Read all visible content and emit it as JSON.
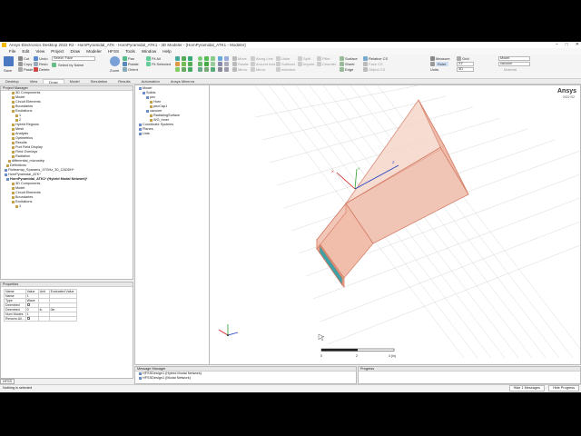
{
  "window": {
    "title": "Ansys Electronics Desktop 2022 R2 - HornPyramidal_ATK - HornPyramidal_ATK1 - 3D Modeler - [HornPyramidal_ATK1 - Modeler]",
    "controls": [
      "–",
      "□",
      "✕"
    ]
  },
  "menu": [
    "File",
    "Edit",
    "View",
    "Project",
    "Draw",
    "Modeler",
    "HFSS",
    "Tools",
    "Window",
    "Help"
  ],
  "ribbon": {
    "save": "Save",
    "cut": "Cut",
    "copy": "Copy",
    "paste": "Paste",
    "delete": "Delete",
    "undo": "Undo",
    "redo": "Redo",
    "select_label": "Select: Face",
    "select_by_name": "Select by Name",
    "zoom": "Zoom",
    "pan": "Pan",
    "rotate": "Rotate",
    "orient": "Orient",
    "fit_all": "Fit All",
    "fit_selected": "Fit Selected",
    "move": "Move",
    "rotate2": "Rotate",
    "mirror": "Mirror",
    "along_line": "Along Line",
    "around_axis": "Around Axis",
    "duplicate_mirror": "Mirror",
    "unite": "Unite",
    "subtract": "Subtract",
    "intersect": "Intersect",
    "split": "Split",
    "imprint": "Imprint",
    "fillet": "Fillet",
    "chamfer": "Chamfer",
    "surface": "Surface",
    "sheet": "Sheet",
    "edge": "Edge",
    "relative_cs": "Relative CS",
    "face_cs": "Face CS",
    "object_cs": "Object CS",
    "measure": "Measure",
    "ruler": "Ruler",
    "grid": "Grid",
    "units_label": "Units",
    "xy": "XY",
    "d3": "3D",
    "mm": "mm",
    "model": "Model",
    "vacuum": "vacuum",
    "material": "Material"
  },
  "tabs": [
    "Desktop",
    "View",
    "Draw",
    "Model",
    "Simulation",
    "Results",
    "Automation",
    "Ansys Minerva"
  ],
  "active_tab": "Draw",
  "project_manager": {
    "title": "Project Manager",
    "items": [
      "3D Components",
      "Model",
      "Circuit Elements",
      "Boundaries",
      "Excitations",
      "1",
      "2",
      "Hybrid Regions",
      "Mesh",
      "Analysis",
      "Optimetrics",
      "Results",
      "Port Field Display",
      "Field Overlays",
      "Radiation",
      "differential_microstrip",
      "Definitions",
      "Finitearray_Sparams_37GHz_30_CADDH*",
      "HornPyramidal_ATK*",
      "HornPyramidal_ATK1* (Hybrid Modal Network)*",
      "3D Components",
      "Model",
      "Circuit Elements",
      "Boundaries",
      "Excitations",
      "1"
    ]
  },
  "properties": {
    "title": "Properties",
    "headers": [
      "Name",
      "Value",
      "Unit",
      "Evaluated Value"
    ],
    "rows": [
      [
        "Name",
        "1",
        "",
        ""
      ],
      [
        "Type",
        "Wave",
        "",
        ""
      ],
      [
        "Deembed",
        "",
        "",
        ""
      ],
      [
        "Deembed",
        "0",
        "in",
        "0in"
      ],
      [
        "Num Modes",
        "1",
        "",
        ""
      ],
      [
        "Renorm All...",
        "",
        "",
        ""
      ]
    ]
  },
  "model_tree": {
    "items": [
      "Model",
      "Solids",
      "pec",
      "Horn",
      "pecCap1",
      "vacuum",
      "RadiatingSurface",
      "WG_inner",
      "Coordinate Systems",
      "Planes",
      "Lists"
    ]
  },
  "viewport": {
    "brand": "Ansys",
    "version": "2022 R2",
    "scale_labels": [
      "0",
      "2",
      "4 (in)"
    ]
  },
  "message_manager": {
    "title": "Message Manager",
    "items": [
      "HFSSDesign1 (Hybrid Modal Network)",
      "HFSSDesign1 (Modal Network)"
    ]
  },
  "progress": {
    "title": "Progress"
  },
  "hfss_tab": "HFSS",
  "status": {
    "left": "Nothing is selected",
    "hide_messages": "Hide 1 Messages",
    "hide_progress": "Hide Progress"
  },
  "colors": {
    "accent": "#f5b700",
    "horn": "#e8a08a",
    "port": "#3fa0a6"
  }
}
